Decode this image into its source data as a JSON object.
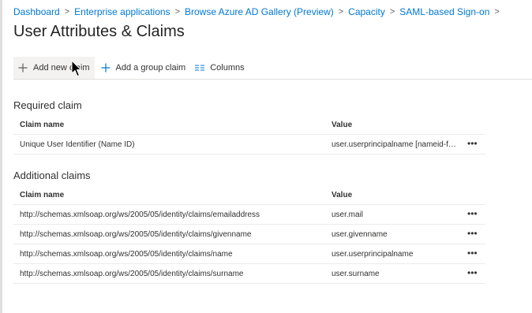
{
  "breadcrumb": [
    {
      "label": "Dashboard"
    },
    {
      "label": "Enterprise applications"
    },
    {
      "label": "Browse Azure AD Gallery (Preview)"
    },
    {
      "label": "Capacity"
    },
    {
      "label": "SAML-based Sign-on"
    }
  ],
  "page": {
    "title": "User Attributes & Claims"
  },
  "toolbar": {
    "add_claim": "Add new claim",
    "add_group_claim": "Add a group claim",
    "columns": "Columns"
  },
  "icons": {
    "add": "plus-icon",
    "columns": "columns-icon",
    "more": "more-ellipsis-icon",
    "breadcrumb_sep": "chevron-right-icon",
    "cursor": "mouse-pointer-icon"
  },
  "required": {
    "title": "Required claim",
    "headers": {
      "name": "Claim name",
      "value": "Value"
    },
    "rows": [
      {
        "name": "Unique User Identifier (Name ID)",
        "value": "user.userprincipalname [nameid-for..."
      }
    ]
  },
  "additional": {
    "title": "Additional claims",
    "headers": {
      "name": "Claim name",
      "value": "Value"
    },
    "rows": [
      {
        "name": "http://schemas.xmlsoap.org/ws/2005/05/identity/claims/emailaddress",
        "value": "user.mail"
      },
      {
        "name": "http://schemas.xmlsoap.org/ws/2005/05/identity/claims/givenname",
        "value": "user.givenname"
      },
      {
        "name": "http://schemas.xmlsoap.org/ws/2005/05/identity/claims/name",
        "value": "user.userprincipalname"
      },
      {
        "name": "http://schemas.xmlsoap.org/ws/2005/05/identity/claims/surname",
        "value": "user.surname"
      }
    ]
  },
  "more_glyph": "•••",
  "colors": {
    "link": "#0078d4",
    "text": "#323130",
    "border": "#edebe9"
  }
}
